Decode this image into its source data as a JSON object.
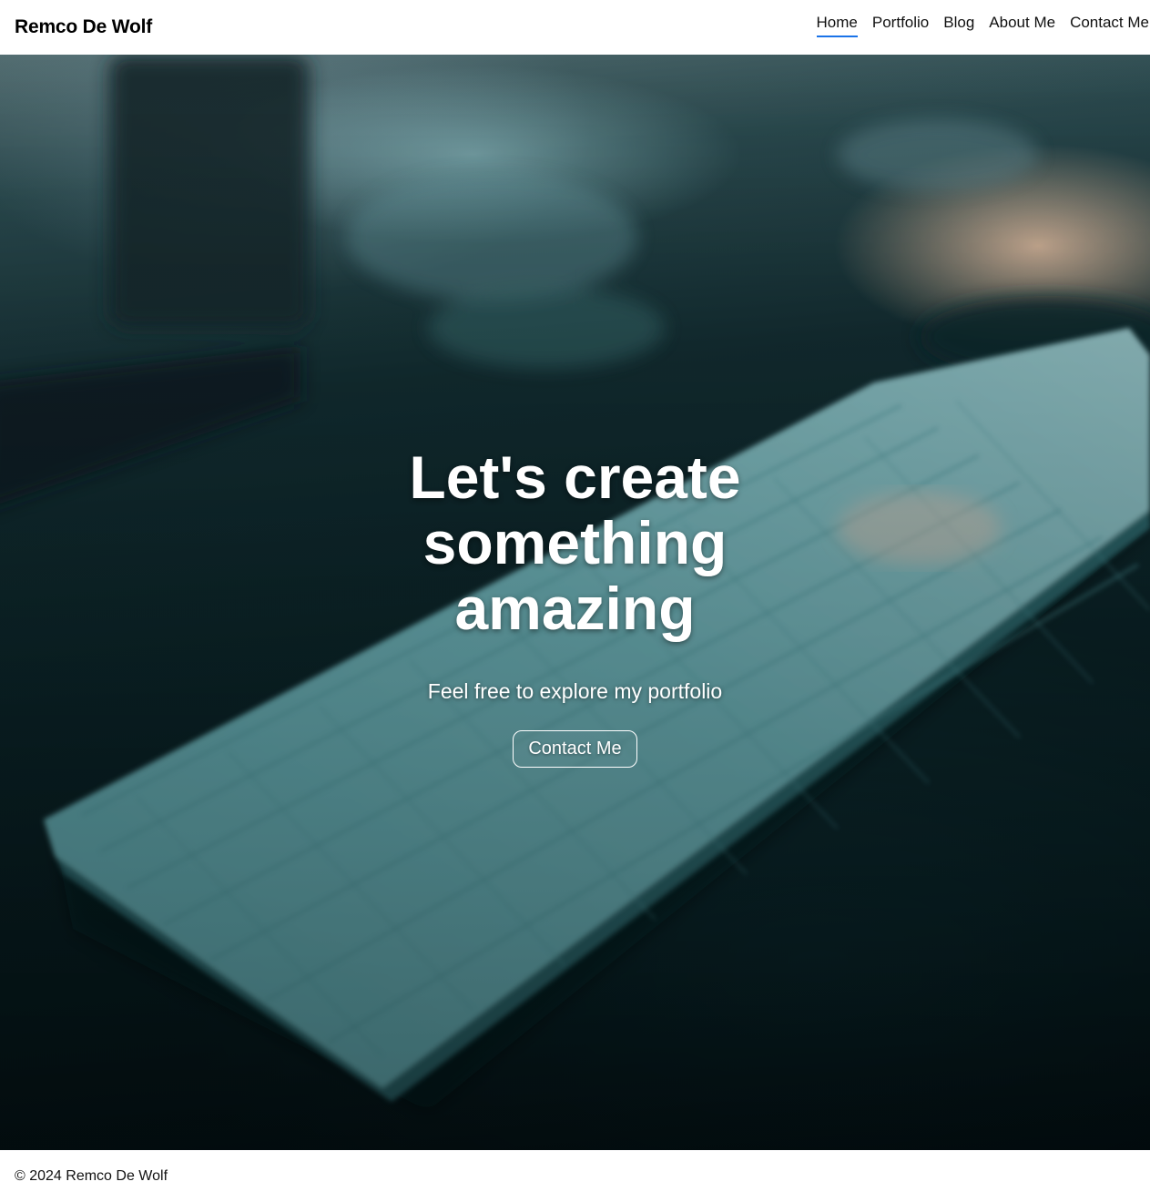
{
  "header": {
    "brand": "Remco De Wolf",
    "nav": [
      {
        "label": "Home",
        "active": true
      },
      {
        "label": "Portfolio",
        "active": false
      },
      {
        "label": "Blog",
        "active": false
      },
      {
        "label": "About Me",
        "active": false
      },
      {
        "label": "Contact Me",
        "active": false
      }
    ],
    "active_underline_color": "#1a73e8"
  },
  "hero": {
    "title": "Let's create something amazing",
    "subtitle": "Feel free to explore my portfolio",
    "button_label": "Contact Me",
    "background_image": "blurred photo of a white keyboard on a dark desk"
  },
  "footer": {
    "text": "© 2024 Remco De Wolf"
  }
}
